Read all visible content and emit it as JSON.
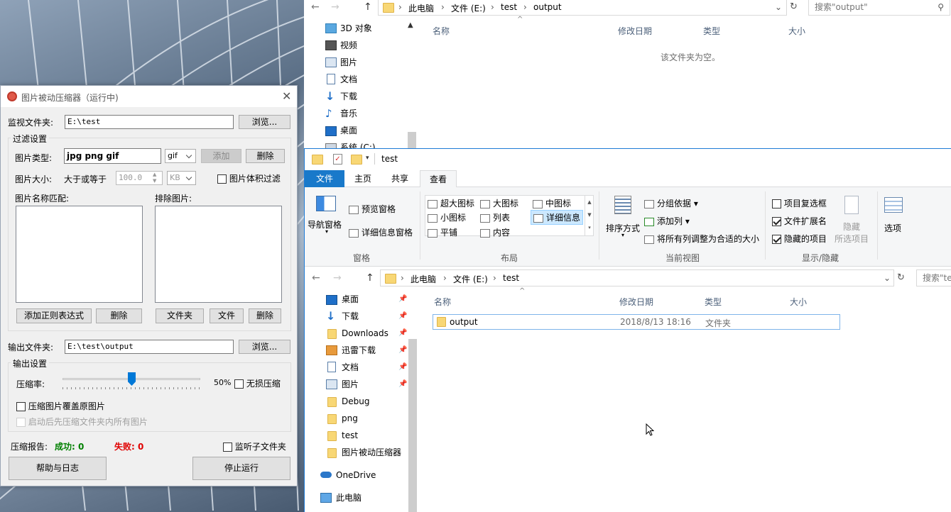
{
  "top_explorer": {
    "breadcrumb": [
      "此电脑",
      "文件 (E:)",
      "test",
      "output"
    ],
    "search_placeholder": "搜索\"output\"",
    "columns": [
      "名称",
      "修改日期",
      "类型",
      "大小"
    ],
    "empty_message": "该文件夹为空。",
    "tree": [
      "3D 对象",
      "视频",
      "图片",
      "文档",
      "下载",
      "音乐",
      "桌面",
      "系统 (C:)"
    ]
  },
  "compressor": {
    "title": "图片被动压缩器（运行中)",
    "watch_label": "监视文件夹:",
    "watch_value": "E:\\test",
    "browse_label": "浏览...",
    "filter_group": "过滤设置",
    "type_label": "图片类型:",
    "type_value": "jpg png gif",
    "type_select": "gif",
    "add_label": "添加",
    "delete_label": "删除",
    "size_label": "图片大小:",
    "size_op": "大于或等于",
    "size_value": "100.0",
    "size_unit": "KB",
    "size_filter_label": "图片体积过滤",
    "name_match_label": "图片名称匹配:",
    "exclude_label": "排除图片:",
    "add_regex_label": "添加正则表达式",
    "delete_regex_label": "删除",
    "folder_label": "文件夹",
    "file_label": "文件",
    "delete_excl_label": "删除",
    "output_label": "输出文件夹:",
    "output_value": "E:\\test\\output",
    "output_browse": "浏览...",
    "output_group": "输出设置",
    "ratio_label": "压缩率:",
    "ratio_value": "50%",
    "ratio_fraction": 0.5,
    "lossless_label": "无损压缩",
    "overwrite_label": "压缩图片覆盖原图片",
    "startup_label": "启动后先压缩文件夹内所有图片",
    "report_label": "压缩报告:",
    "success_text": "成功: 0",
    "fail_text": "失败: 0",
    "subfolder_label": "监听子文件夹",
    "help_label": "帮助与日志",
    "stop_label": "停止运行",
    "colors": {
      "success": "#008000",
      "fail": "#e00000"
    }
  },
  "main_explorer": {
    "qat_title": "test",
    "tabs": [
      "文件",
      "主页",
      "共享",
      "查看"
    ],
    "ribbon": {
      "nav_pane": "导航窗格",
      "preview_pane": "预览窗格",
      "details_pane": "详细信息窗格",
      "pane_group": "窗格",
      "layout_items": [
        "超大图标",
        "大图标",
        "中图标",
        "小图标",
        "列表",
        "详细信息",
        "平铺",
        "内容"
      ],
      "layout_group": "布局",
      "sort_by": "排序方式",
      "group_by": "分组依据",
      "add_column": "添加列",
      "fit_columns": "将所有列调整为合适的大小",
      "current_view_group": "当前视图",
      "item_checkboxes": "项目复选框",
      "file_extensions": "文件扩展名",
      "hidden_items": "隐藏的项目",
      "hide_selected_top": "隐藏",
      "hide_selected_bottom": "所选项目",
      "options": "选项",
      "show_hide_group": "显示/隐藏"
    },
    "breadcrumb": [
      "此电脑",
      "文件 (E:)",
      "test"
    ],
    "search_placeholder": "搜索\"te",
    "columns": [
      "名称",
      "修改日期",
      "类型",
      "大小"
    ],
    "rows": [
      {
        "name": "output",
        "date": "2018/8/13 18:16",
        "type": "文件夹",
        "size": ""
      }
    ],
    "tree": [
      "桌面",
      "下载",
      "Downloads",
      "迅雷下载",
      "文档",
      "图片",
      "Debug",
      "png",
      "test",
      "图片被动压缩器",
      "OneDrive",
      "此电脑"
    ]
  }
}
